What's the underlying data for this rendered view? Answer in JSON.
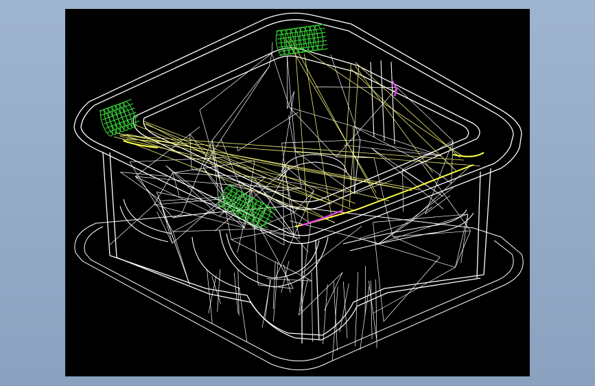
{
  "colors": {
    "background": "#8fa6c4",
    "viewport": "#000000",
    "wireframe": "#ffffff",
    "guide_lines": "#f2f27a",
    "highlight_features": "#33cc33",
    "marker_features": "#e040e0"
  },
  "icons": {
    "model": "wireframe-3d-model",
    "feature": "green-handle-feature"
  }
}
